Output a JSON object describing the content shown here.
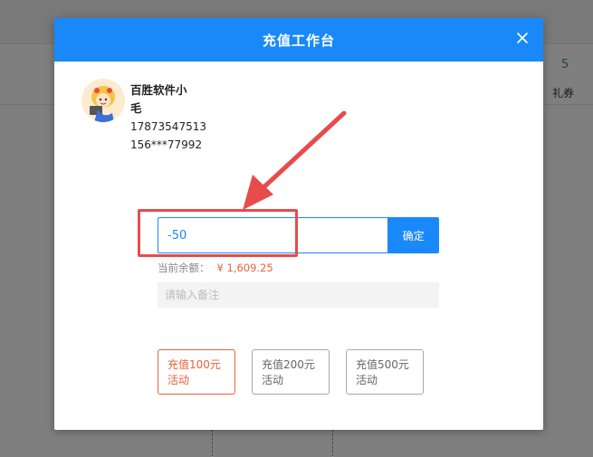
{
  "background": {
    "stat_value": "5",
    "stat_label": "礼券"
  },
  "dialog": {
    "title": "充值工作台",
    "header_color": "#1989fa"
  },
  "member": {
    "name": "百胜软件小毛",
    "phone": "17873547513",
    "card": "156***77992"
  },
  "recharge": {
    "amount_value": "-50",
    "confirm_label": "确定",
    "balance_label": "当前余额：",
    "balance_value": "¥ 1,609.25",
    "remark_placeholder": "请输入备注"
  },
  "packages": [
    {
      "line1": "充值100元",
      "line2": "活动",
      "active": true
    },
    {
      "line1": "充值200元",
      "line2": "活动",
      "active": false
    },
    {
      "line1": "充值500元",
      "line2": "活动",
      "active": false
    }
  ],
  "annotation": {
    "highlight_color": "#e84b4b"
  }
}
